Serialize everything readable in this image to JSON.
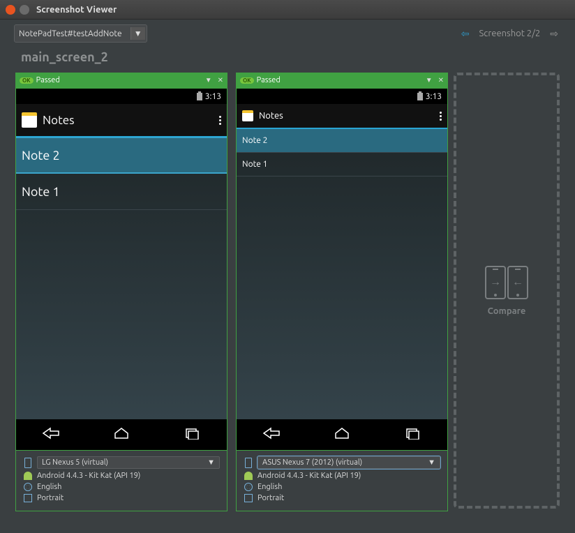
{
  "window": {
    "title": "Screenshot Viewer"
  },
  "toolbar": {
    "testDropdown": "NotePadTest#testAddNote",
    "counter": "Screenshot 2/2"
  },
  "screenName": "main_screen_2",
  "panels": [
    {
      "status": "Passed",
      "statusBadge": "OK",
      "android": {
        "time": "3:13",
        "appTitle": "Notes",
        "notes": [
          "Note 2",
          "Note 1"
        ],
        "selectedIndex": 0,
        "size": "large"
      },
      "meta": {
        "device": "LG Nexus 5 (virtual)",
        "os": "Android 4.4.3 - Kit Kat (API 19)",
        "language": "English",
        "orientation": "Portrait"
      }
    },
    {
      "status": "Passed",
      "statusBadge": "OK",
      "android": {
        "time": "3:13",
        "appTitle": "Notes",
        "notes": [
          "Note 2",
          "Note 1"
        ],
        "selectedIndex": 0,
        "size": "small"
      },
      "meta": {
        "device": "ASUS Nexus 7 (2012) (virtual)",
        "os": "Android 4.4.3 - Kit Kat (API 19)",
        "language": "English",
        "orientation": "Portrait"
      }
    }
  ],
  "compare": {
    "label": "Compare"
  }
}
